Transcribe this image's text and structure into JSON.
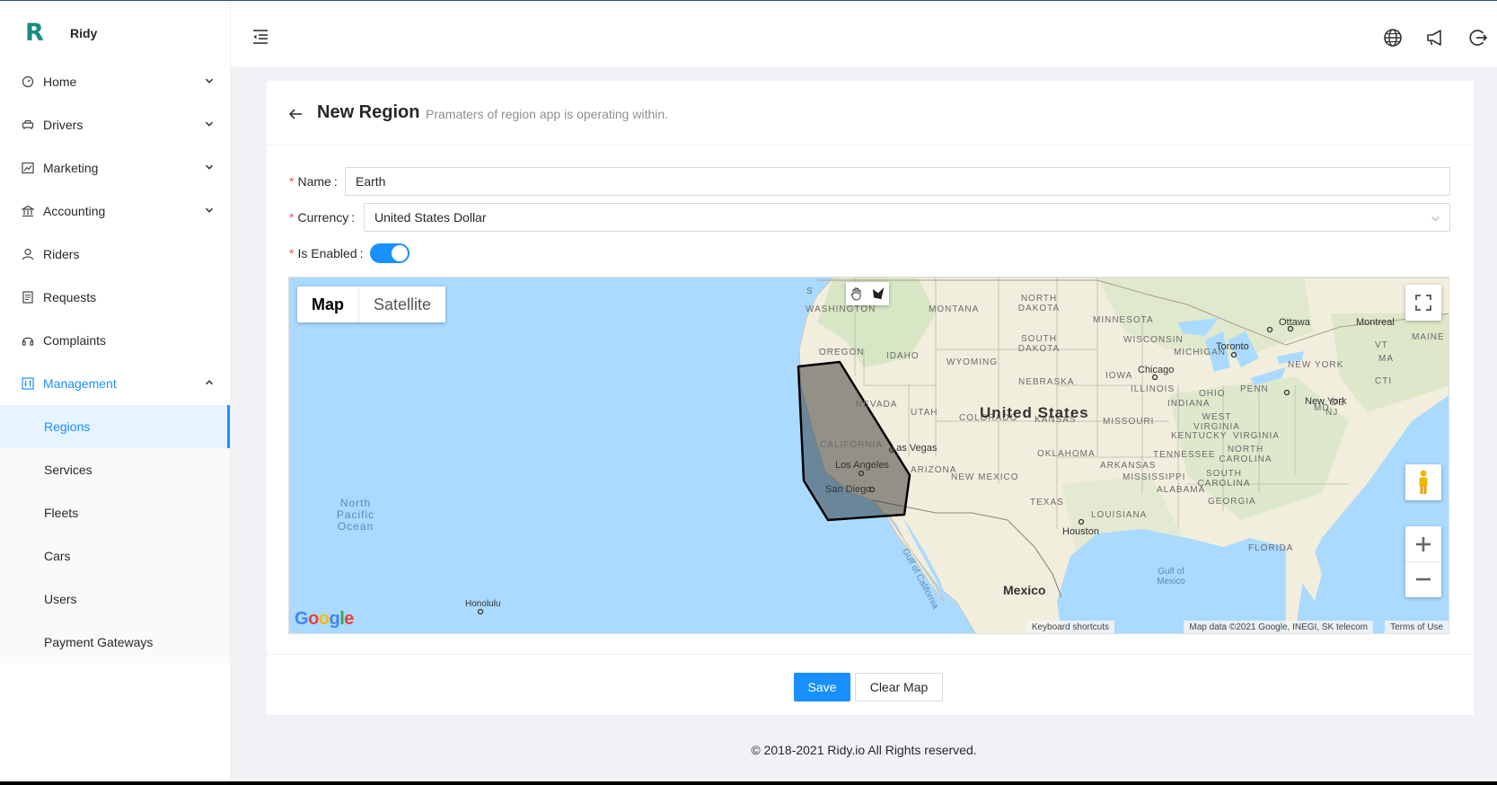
{
  "app": {
    "logo_letter": "R",
    "name": "Ridy"
  },
  "sidebar": {
    "items": [
      {
        "label": "Home",
        "icon": "dashboard-icon"
      },
      {
        "label": "Drivers",
        "icon": "car-icon"
      },
      {
        "label": "Marketing",
        "icon": "chart-icon"
      },
      {
        "label": "Accounting",
        "icon": "bank-icon"
      },
      {
        "label": "Riders",
        "icon": "user-icon"
      },
      {
        "label": "Requests",
        "icon": "file-icon"
      },
      {
        "label": "Complaints",
        "icon": "headset-icon"
      },
      {
        "label": "Management",
        "icon": "control-icon"
      }
    ],
    "management_sub": [
      "Regions",
      "Services",
      "Fleets",
      "Cars",
      "Users",
      "Payment Gateways"
    ],
    "active_sub": "Regions"
  },
  "header": {
    "icons": [
      "globe-icon",
      "notification-icon",
      "logout-icon"
    ]
  },
  "page": {
    "title": "New Region",
    "subtitle": "Pramaters of region app is operating within."
  },
  "form": {
    "name_label": "Name",
    "name_value": "Earth",
    "currency_label": "Currency",
    "currency_value": "United States Dollar",
    "enabled_label": "Is Enabled",
    "enabled": true,
    "colon": ":"
  },
  "map": {
    "type_map": "Map",
    "type_satellite": "Satellite",
    "states": [
      "WASHINGTON",
      "MONTANA",
      "NORTH DAKOTA",
      "MINNESOTA",
      "OREGON",
      "IDAHO",
      "SOUTH DAKOTA",
      "WYOMING",
      "WISCONSIN",
      "MICHIGAN",
      "NEBRASKA",
      "IOWA",
      "NEVADA",
      "UTAH",
      "COLORADO",
      "KANSAS",
      "ILLINOIS",
      "INDIANA",
      "OHIO",
      "PENN",
      "CALIFORNIA",
      "MISSOURI",
      "WEST VIRGINIA",
      "VIRGINIA",
      "KENTUCKY",
      "ARIZONA",
      "OKLAHOMA",
      "NEW MEXICO",
      "ARKANSAS",
      "TENNESSEE",
      "NORTH CAROLINA",
      "SOUTH CAROLINA",
      "MISSISSIPPI",
      "ALABAMA",
      "GEORGIA",
      "TEXAS",
      "LOUISIANA",
      "FLORIDA",
      "NEW YORK",
      "MAINE",
      "VT",
      "MA",
      "CTI",
      "MD",
      "DE",
      "NJ"
    ],
    "cities": [
      "Ottawa",
      "Montreal",
      "Toronto",
      "Chicago",
      "New York",
      "Las Vegas",
      "Los Angeles",
      "San Diego",
      "Houston",
      "Honolulu"
    ],
    "country": "United States",
    "mexico": "Mexico",
    "ocean": "North Pacific Ocean",
    "gulf_california": "Gulf of California",
    "gulf_mexico": "Gulf of Mexico",
    "google": "Google",
    "attr_shortcuts": "Keyboard shortcuts",
    "attr_data": "Map data ©2021 Google, INEGI, SK telecom",
    "attr_terms": "Terms of Use",
    "seattle_fragment": "S"
  },
  "actions": {
    "save": "Save",
    "clear": "Clear Map"
  },
  "footer": {
    "text": "© 2018-2021 Ridy.io All Rights reserved."
  },
  "colors": {
    "primary": "#1890ff",
    "brand": "#1a8c7e",
    "water": "#aadaff",
    "land": "#f2eedd"
  }
}
